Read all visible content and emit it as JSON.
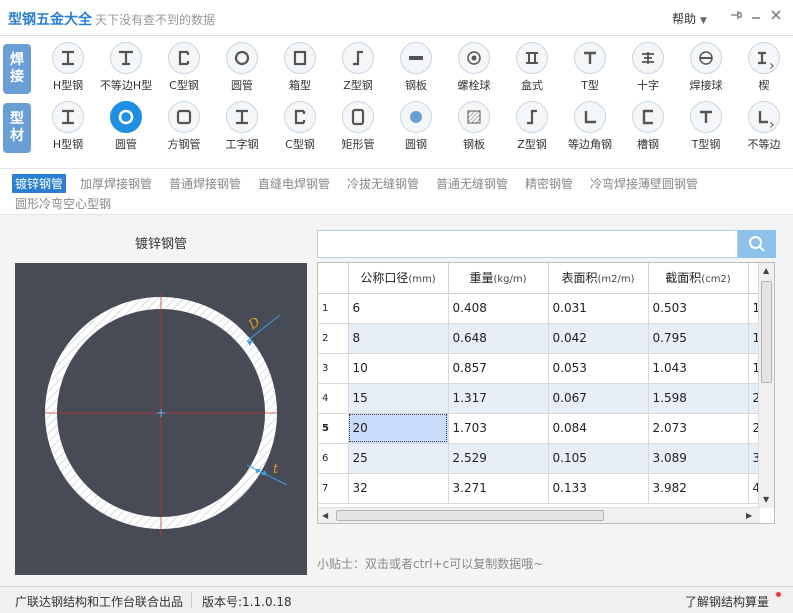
{
  "app": {
    "title": "型钢五金大全",
    "subtitle": "天下没有查不到的数据",
    "help": "帮助"
  },
  "rows": [
    {
      "label": [
        "焊",
        "接"
      ],
      "items": [
        {
          "label": "H型钢",
          "icon": "h-beam-icon"
        },
        {
          "label": "不等边H型",
          "icon": "unequal-h-beam-icon"
        },
        {
          "label": "C型钢",
          "icon": "c-channel-icon"
        },
        {
          "label": "圆管",
          "icon": "round-tube-icon"
        },
        {
          "label": "箱型",
          "icon": "box-section-icon"
        },
        {
          "label": "Z型钢",
          "icon": "z-section-icon"
        },
        {
          "label": "钢板",
          "icon": "steel-plate-icon"
        },
        {
          "label": "螺栓球",
          "icon": "bolt-ball-icon"
        },
        {
          "label": "盒式",
          "icon": "box-type-icon"
        },
        {
          "label": "T型",
          "icon": "t-section-icon"
        },
        {
          "label": "十字",
          "icon": "cross-section-icon"
        },
        {
          "label": "焊接球",
          "icon": "welded-ball-icon"
        },
        {
          "label": "楔",
          "icon": "wedge-icon"
        }
      ]
    },
    {
      "label": [
        "型",
        "材"
      ],
      "items": [
        {
          "label": "H型钢",
          "icon": "h-beam-icon"
        },
        {
          "label": "圆管",
          "icon": "round-tube-icon",
          "active": true
        },
        {
          "label": "方钢管",
          "icon": "square-tube-icon"
        },
        {
          "label": "工字钢",
          "icon": "i-beam-icon"
        },
        {
          "label": "C型钢",
          "icon": "c-channel-icon"
        },
        {
          "label": "矩形管",
          "icon": "rect-tube-icon"
        },
        {
          "label": "圆钢",
          "icon": "round-bar-icon"
        },
        {
          "label": "钢板",
          "icon": "steel-plate-icon"
        },
        {
          "label": "Z型钢",
          "icon": "z-section-icon"
        },
        {
          "label": "等边角钢",
          "icon": "equal-angle-icon"
        },
        {
          "label": "槽钢",
          "icon": "channel-icon"
        },
        {
          "label": "T型钢",
          "icon": "t-section-icon"
        },
        {
          "label": "不等边",
          "icon": "unequal-angle-icon"
        }
      ]
    }
  ],
  "subtypes": {
    "items": [
      "镀锌钢管",
      "加厚焊接钢管",
      "普通焊接钢管",
      "直缝电焊钢管",
      "冷拔无缝钢管",
      "普通无缝钢管",
      "精密钢管",
      "冷弯焊接薄壁圆钢管"
    ],
    "second_line": "圆形冷弯空心型钢",
    "active_index": 0
  },
  "drawing": {
    "title": "镀锌钢管",
    "dim_d": "D",
    "dim_t": "t",
    "bg_color": "#464b55"
  },
  "search": {
    "value": "",
    "icon": "search-icon"
  },
  "table": {
    "headers": [
      {
        "name": "公称口径",
        "unit": "(mm)"
      },
      {
        "name": "重量",
        "unit": "(kg/m)"
      },
      {
        "name": "表面积",
        "unit": "(m2/m)"
      },
      {
        "name": "截面积",
        "unit": "(cm2)"
      }
    ],
    "rows": [
      {
        "n": "1",
        "cells": [
          "6",
          "0.408",
          "0.031",
          "0.503"
        ],
        "extra": "1"
      },
      {
        "n": "2",
        "cells": [
          "8",
          "0.648",
          "0.042",
          "0.795"
        ],
        "extra": "1"
      },
      {
        "n": "3",
        "cells": [
          "10",
          "0.857",
          "0.053",
          "1.043"
        ],
        "extra": "1"
      },
      {
        "n": "4",
        "cells": [
          "15",
          "1.317",
          "0.067",
          "1.598"
        ],
        "extra": "2"
      },
      {
        "n": "5",
        "cells": [
          "20",
          "1.703",
          "0.084",
          "2.073"
        ],
        "extra": "2"
      },
      {
        "n": "6",
        "cells": [
          "25",
          "2.529",
          "0.105",
          "3.089"
        ],
        "extra": "3"
      },
      {
        "n": "7",
        "cells": [
          "32",
          "3.271",
          "0.133",
          "3.982"
        ],
        "extra": "4"
      }
    ],
    "selected_row": 4
  },
  "tip": "小贴士：双击或者ctrl+c可以复制数据哦~",
  "status": {
    "producer": "广联达钢结构和工作台联合出品",
    "version": "版本号:1.1.0.18",
    "link": "了解钢结构算量"
  },
  "colors": {
    "accent": "#2b7fd1",
    "active_icon": "#1e8fe1",
    "category_label": "#6a9fd6",
    "row_alt": "#e8eef8",
    "selected_cell": "#c9dbfb"
  }
}
